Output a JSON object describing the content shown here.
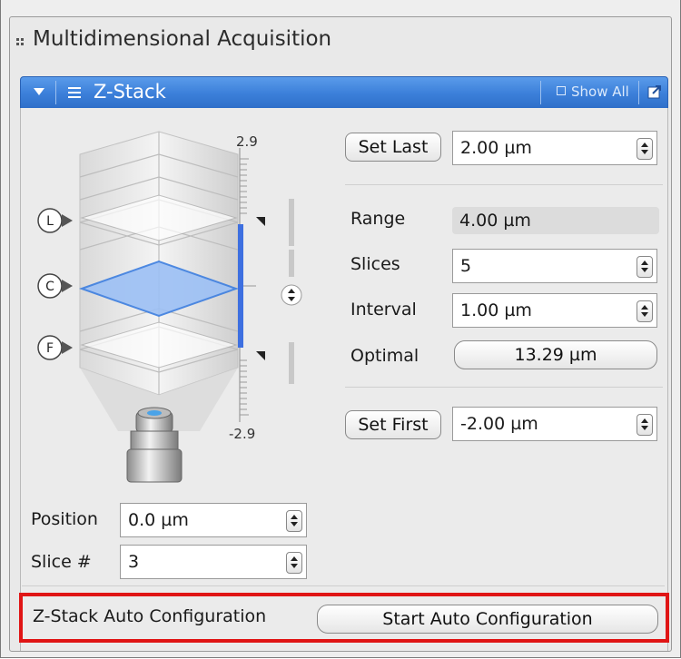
{
  "panel": {
    "title": "Multidimensional Acquisition"
  },
  "zstack": {
    "title": "Z-Stack",
    "show_all": "Show All",
    "scale": {
      "top": "2.9",
      "bottom": "-2.9"
    },
    "markers": [
      "L",
      "C",
      "F"
    ],
    "set_last": {
      "label": "Set Last",
      "value": "2.00 µm"
    },
    "range": {
      "label": "Range",
      "value": "4.00 µm"
    },
    "slices": {
      "label": "Slices",
      "value": "5"
    },
    "interval": {
      "label": "Interval",
      "value": "1.00 µm"
    },
    "optimal": {
      "label": "Optimal",
      "value": "13.29 µm"
    },
    "set_first": {
      "label": "Set First",
      "value": "-2.00 µm"
    },
    "position": {
      "label": "Position",
      "value": "0.0 µm"
    },
    "slice_num": {
      "label": "Slice #",
      "value": "3"
    },
    "auto_config": {
      "label": "Z-Stack Auto Configuration",
      "button": "Start Auto Configuration"
    }
  },
  "colors": {
    "header_blue": "#3b7fd9",
    "highlight_red": "#e01515",
    "plane_blue": "#9cc0f5"
  }
}
